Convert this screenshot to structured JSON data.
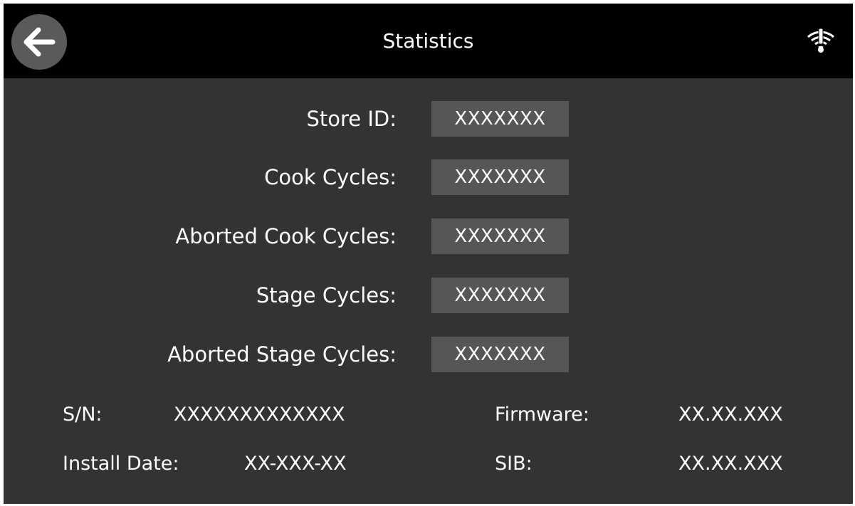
{
  "header": {
    "title": "Statistics",
    "back_icon": "arrow-left-icon",
    "wifi_icon": "wifi-warning-icon"
  },
  "stats": [
    {
      "label": "Store ID:",
      "value": "XXXXXXX"
    },
    {
      "label": "Cook Cycles:",
      "value": "XXXXXXX"
    },
    {
      "label": "Aborted Cook Cycles:",
      "value": "XXXXXXX"
    },
    {
      "label": "Stage Cycles:",
      "value": "XXXXXXX"
    },
    {
      "label": "Aborted Stage Cycles:",
      "value": "XXXXXXX"
    }
  ],
  "info": {
    "serial_label": "S/N:",
    "serial_value": "XXXXXXXXXXXXX",
    "install_label": "Install Date:",
    "install_value": "XX-XXX-XX",
    "firmware_label": "Firmware:",
    "firmware_value": "XX.XX.XXX",
    "sib_label": "SIB:",
    "sib_value": "XX.XX.XXX"
  },
  "colors": {
    "background": "#333333",
    "header_bg": "#000000",
    "value_box": "#565656",
    "text": "#ffffff"
  }
}
